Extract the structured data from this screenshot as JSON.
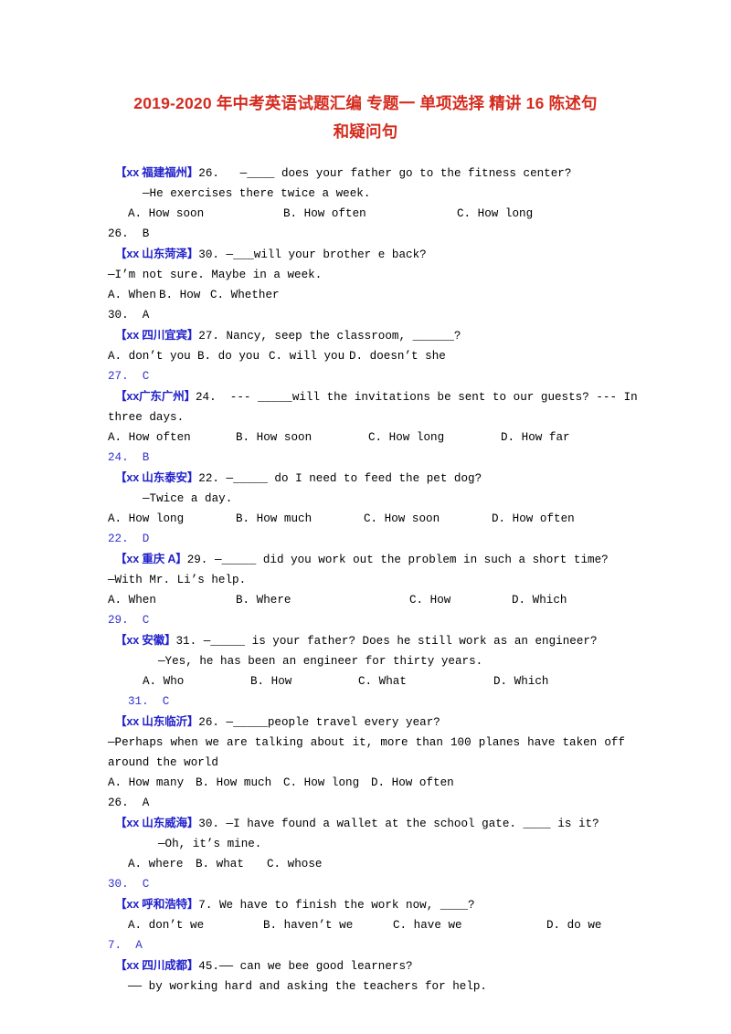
{
  "document": {
    "title_line_1": "2019-2020 年中考英语试题汇编 专题一  单项选择 精讲 16 陈述句",
    "title_line_2": "和疑问句",
    "title_color": "#d52b1e",
    "tag_color": "#2222cc",
    "answer_color": "#3333cc",
    "body_color": "#000000"
  },
  "items": [
    {
      "tag": "【xx 福建福州】",
      "number": "26.",
      "question": "—____ does your father go to the fitness center?",
      "reply": "—He exercises there twice a week.",
      "options": [
        "A. How soon",
        "B. How often",
        "C. How long"
      ],
      "answer": "26.  B",
      "answer_style": "black"
    },
    {
      "tag": "【xx 山东菏泽】",
      "number": "30.",
      "question": "—___will your brother e back?",
      "reply": "—I’m not sure. Maybe in a week.",
      "options": [
        "A. When",
        "B. How",
        "C. Whether"
      ],
      "answer": "30.  A",
      "answer_style": "black"
    },
    {
      "tag": "【xx 四川宜宾】",
      "number": "27.",
      "question": "Nancy, seep the classroom, ______?",
      "reply": "",
      "options": [
        "A. don’t you",
        "B. do you",
        "C. will you",
        "D. doesn’t she"
      ],
      "answer": "27.  C",
      "answer_style": "blue"
    },
    {
      "tag": "【xx广东广州】",
      "number": "24.",
      "question_part1": "--- _____will the invitations be sent to our guests? --- In",
      "question_part2": "three days.",
      "options": [
        "A. How often",
        "B. How soon",
        "C. How long",
        "D. How far"
      ],
      "answer": "24.  B",
      "answer_style": "blue"
    },
    {
      "tag": "【xx 山东泰安】",
      "number": "22.",
      "question": "—_____ do I need to feed the pet dog?",
      "reply": "—Twice a day.",
      "options": [
        "A. How long",
        "B. How much",
        "C. How soon",
        "D. How often"
      ],
      "answer": "22.  D",
      "answer_style": "blue"
    },
    {
      "tag": "【xx 重庆 A】",
      "number": "29.",
      "question": "—_____ did you work out the problem in such a short time?",
      "reply": "—With Mr. Li’s help.",
      "options": [
        "A. When",
        "B. Where",
        "C. How",
        "D. Which"
      ],
      "answer": "29.  C",
      "answer_style": "blue"
    },
    {
      "tag": "【xx 安徽】",
      "number": "31.",
      "question": "—_____ is your father? Does he still work as an engineer?",
      "reply": "—Yes, he has been an engineer for thirty years.",
      "options": [
        "A. Who",
        "B. How",
        "C. What",
        "D. Which"
      ],
      "answer": "31.  C",
      "answer_style": "blue"
    },
    {
      "tag": "【xx 山东临沂】",
      "number": "26.",
      "question": "—_____people travel every year?",
      "reply_line1": "—Perhaps when we are talking about it, more than 100 planes have taken off",
      "reply_line2": "around the world",
      "options": [
        "A. How many",
        "B. How much",
        "C. How long",
        "D. How often"
      ],
      "answer": "26.  A",
      "answer_style": "black"
    },
    {
      "tag": "【xx 山东威海】",
      "number": "30.",
      "question": "—I have found a wallet at the school gate. ____ is it?",
      "reply": "—Oh, it’s mine.",
      "options": [
        "A. where",
        "B. what",
        "C. whose"
      ],
      "answer": "30.  C",
      "answer_style": "blue"
    },
    {
      "tag": "【xx 呼和浩特】",
      "number": "7.",
      "question": "We have to finish the work now, ____?",
      "reply": "",
      "options": [
        "A. don’t we",
        "B. haven’t we",
        "C. have we",
        "D. do we"
      ],
      "answer": "7.  A",
      "answer_style": "blue"
    },
    {
      "tag": "【xx 四川成都】",
      "number": "45.",
      "question": "—— can we bee good learners?",
      "reply": "—— by working hard and asking the teachers for help.",
      "options": [],
      "answer": "",
      "answer_style": "blue"
    }
  ]
}
